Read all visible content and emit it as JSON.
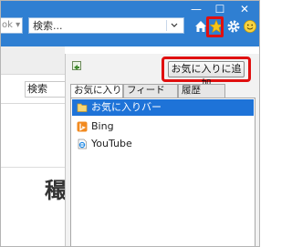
{
  "toolbar": {
    "address_fragment": "ok ▾",
    "search_text": "検索...",
    "window_min": "—",
    "window_max": "☐",
    "window_close": "✕"
  },
  "page": {
    "search_label": "検索",
    "heading_fragment": "穝"
  },
  "favorites_panel": {
    "add_button_label": "お気に入りに追加",
    "tabs": [
      "お気に入り",
      "フィード",
      "履歴"
    ],
    "items": [
      {
        "label": "お気に入りバー",
        "icon": "folder-icon"
      },
      {
        "label": "Bing",
        "icon": "bing-icon"
      },
      {
        "label": "YouTube",
        "icon": "ie-page-icon"
      }
    ]
  },
  "colors": {
    "titlebar": "#2f7fd2",
    "highlight": "#e01010",
    "selection": "#1e73d8"
  }
}
